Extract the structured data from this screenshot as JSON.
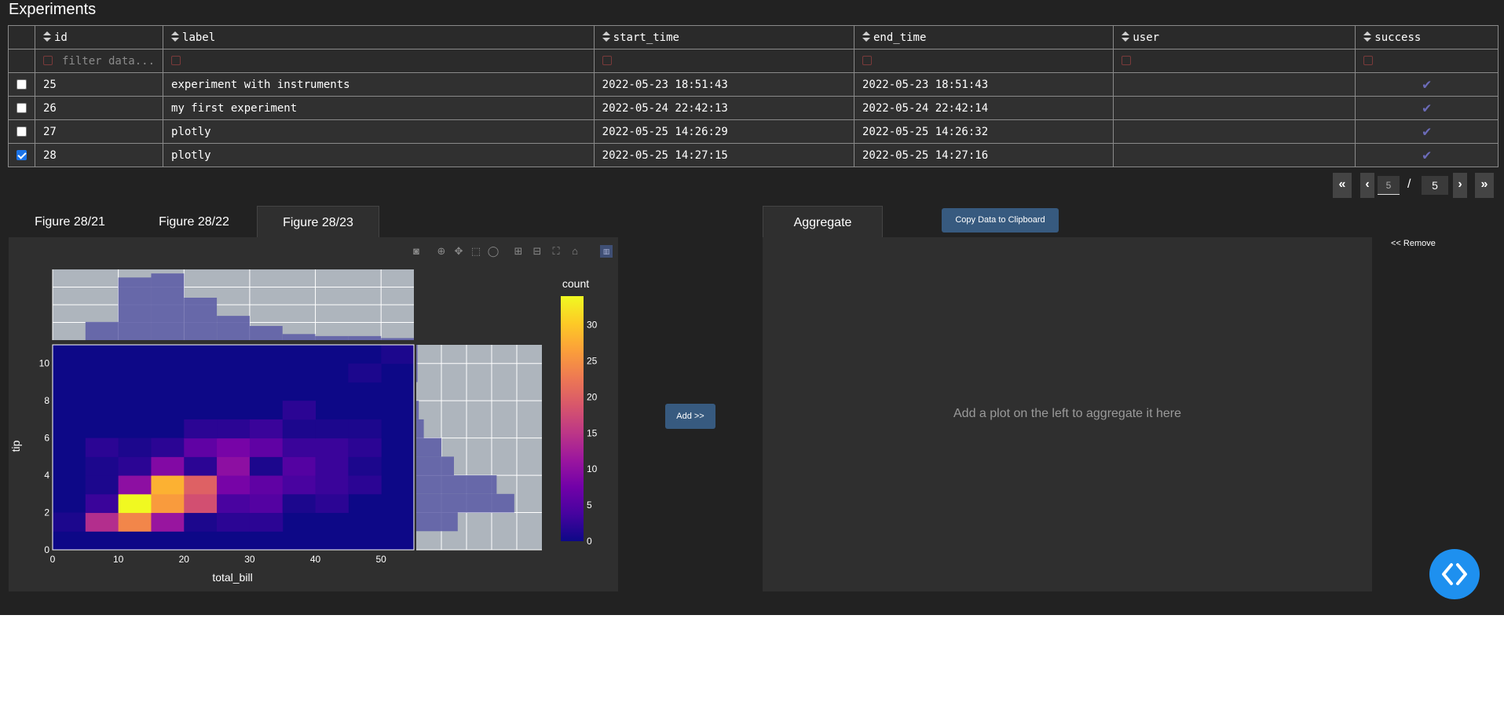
{
  "app": {
    "title": "Experiments"
  },
  "table": {
    "columns": [
      "id",
      "label",
      "start_time",
      "end_time",
      "user",
      "success"
    ],
    "filter_placeholder": "filter data...",
    "rows": [
      {
        "id": "25",
        "label": "experiment with instruments",
        "start_time": "2022-05-23 18:51:43",
        "end_time": "2022-05-23 18:51:43",
        "user": "",
        "success": "✔",
        "selected": false
      },
      {
        "id": "26",
        "label": "my first experiment",
        "start_time": "2022-05-24 22:42:13",
        "end_time": "2022-05-24 22:42:14",
        "user": "",
        "success": "✔",
        "selected": false
      },
      {
        "id": "27",
        "label": "plotly",
        "start_time": "2022-05-25 14:26:29",
        "end_time": "2022-05-25 14:26:32",
        "user": "",
        "success": "✔",
        "selected": false
      },
      {
        "id": "28",
        "label": "plotly",
        "start_time": "2022-05-25 14:27:15",
        "end_time": "2022-05-25 14:27:16",
        "user": "",
        "success": "✔",
        "selected": true
      }
    ]
  },
  "pagination": {
    "first": "«",
    "prev": "‹",
    "current": "5",
    "separator": "/",
    "total": "5",
    "next": "›",
    "last": "»"
  },
  "tabs": {
    "left": [
      "Figure 28/21",
      "Figure 28/22",
      "Figure 28/23"
    ],
    "active_left": 2,
    "right": [
      "Aggregate"
    ]
  },
  "buttons": {
    "copy": "Copy Data to Clipboard",
    "add": "Add >>",
    "remove": "<< Remove"
  },
  "aggregate": {
    "empty_message": "Add a plot on the left to aggregate it here"
  },
  "modebar_icons": [
    "camera-icon",
    "zoom-icon",
    "pan-icon",
    "box-select-icon",
    "lasso-icon",
    "zoom-in-icon",
    "zoom-out-icon",
    "autoscale-icon",
    "reset-axes-icon",
    "plotly-logo-icon"
  ],
  "colors": {
    "accent": "#375a7f",
    "fab": "#1e90ef",
    "tick": "#6b6bb8",
    "hist": "#5f5fa6"
  },
  "chart_data": {
    "type": "heatmap",
    "title": "",
    "xlabel": "total_bill",
    "ylabel": "tip",
    "xlim": [
      0,
      55
    ],
    "ylim": [
      0,
      11
    ],
    "x_ticks": [
      "0",
      "10",
      "20",
      "30",
      "40",
      "50"
    ],
    "y_ticks": [
      "0",
      "2",
      "4",
      "6",
      "8",
      "10"
    ],
    "colorbar_title": "count",
    "colorbar_ticks": [
      "0",
      "5",
      "10",
      "15",
      "20",
      "25",
      "30"
    ],
    "zlim": [
      0,
      34
    ],
    "x_bin_edges": [
      0,
      5,
      10,
      15,
      20,
      25,
      30,
      35,
      40,
      45,
      50,
      55
    ],
    "y_bin_edges": [
      0,
      1,
      2,
      3,
      4,
      5,
      6,
      7,
      8,
      9,
      10,
      11
    ],
    "z": [
      [
        0,
        0,
        0,
        0,
        0,
        0,
        0,
        0,
        0,
        0,
        0
      ],
      [
        1,
        14,
        24,
        11,
        1,
        2,
        2,
        0,
        0,
        0,
        0
      ],
      [
        0,
        3,
        34,
        26,
        18,
        4,
        5,
        1,
        2,
        0,
        0
      ],
      [
        0,
        1,
        10,
        28,
        20,
        8,
        6,
        4,
        3,
        2,
        0
      ],
      [
        0,
        1,
        2,
        9,
        2,
        10,
        1,
        5,
        3,
        1,
        0
      ],
      [
        0,
        2,
        1,
        2,
        6,
        8,
        6,
        3,
        3,
        2,
        0
      ],
      [
        0,
        0,
        0,
        0,
        2,
        2,
        3,
        1,
        1,
        1,
        0
      ],
      [
        0,
        0,
        0,
        0,
        0,
        0,
        0,
        2,
        0,
        0,
        0
      ],
      [
        0,
        0,
        0,
        0,
        0,
        0,
        0,
        0,
        0,
        0,
        0
      ],
      [
        0,
        0,
        0,
        0,
        0,
        0,
        0,
        0,
        0,
        1,
        0
      ],
      [
        0,
        0,
        0,
        0,
        0,
        0,
        0,
        0,
        0,
        0,
        1
      ]
    ],
    "marginal_x": [
      0,
      9,
      31,
      33,
      21,
      12,
      7,
      3,
      2,
      2,
      1
    ],
    "marginal_y": [
      0,
      33,
      78,
      64,
      30,
      20,
      6,
      2,
      0,
      1,
      1
    ]
  }
}
